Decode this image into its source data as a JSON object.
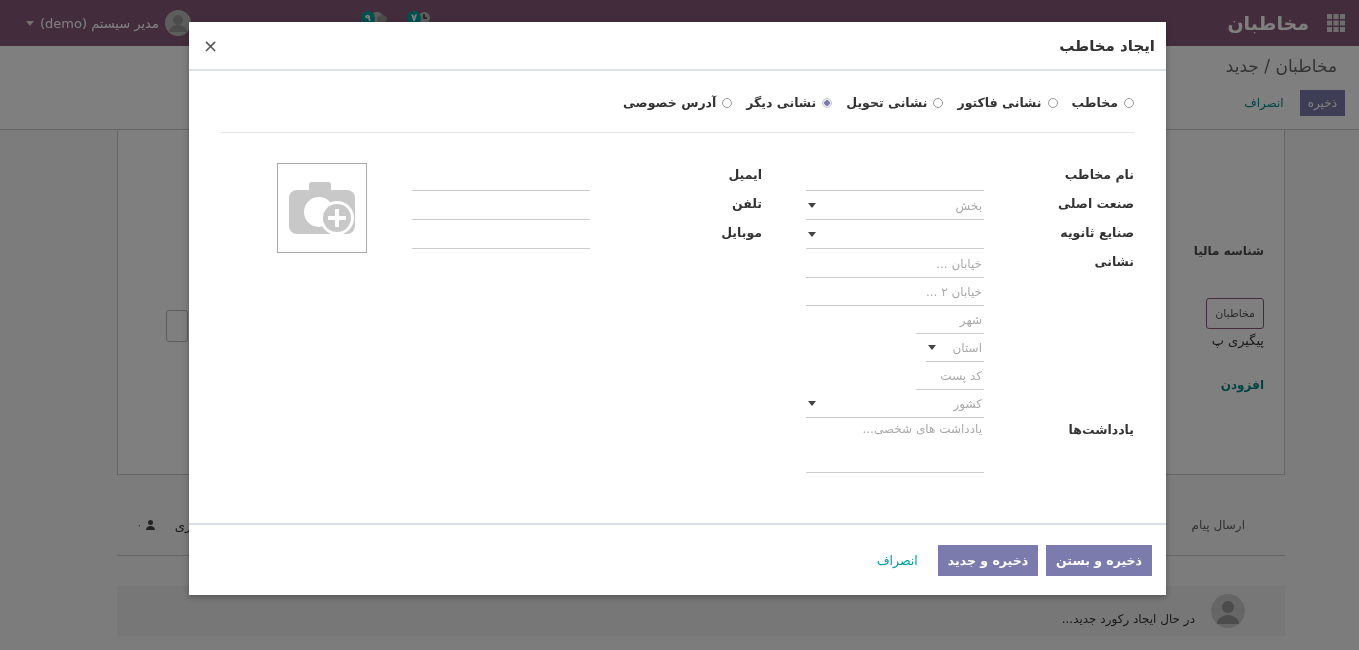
{
  "navbar": {
    "brand": "مخاطبان",
    "activity_count": "۷",
    "message_count": "۹",
    "user": "مدیر سیستم (demo)"
  },
  "control_panel": {
    "breadcrumb": "مخاطبان / جدید",
    "buttons": [
      {
        "label": "ذخیره",
        "kind": "primary"
      },
      {
        "label": "انصراف",
        "kind": "link"
      }
    ]
  },
  "sheet": {
    "tax_label": "شناسه مالیا",
    "contacts_button": "مخاطبان",
    "followup_text": "پیگیری پ",
    "add_link": "افزودن"
  },
  "chatter": {
    "send_message": "ارسال پیام",
    "log_note": "ری",
    "followers_count": "۰",
    "message": "در حال ایجاد رکورد جدید..."
  },
  "dialog": {
    "title": "ایجاد مخاطب",
    "close": "×",
    "radios": [
      {
        "label": "مخاطب",
        "selected": false
      },
      {
        "label": "نشانی فاکتور",
        "selected": false
      },
      {
        "label": "نشانی تحویل",
        "selected": false
      },
      {
        "label": "نشانی دیگر",
        "selected": true
      },
      {
        "label": "آدرس خصوصی",
        "selected": false
      }
    ],
    "right_fields": [
      {
        "label": "نام مخاطب",
        "kind": "text"
      },
      {
        "label": "صنعت اصلی",
        "kind": "select",
        "placeholder": "بخش"
      },
      {
        "label": "صنایع ثانویه",
        "kind": "select"
      },
      {
        "label": "نشانی",
        "kind": "address",
        "parts": [
          {
            "kind": "wide",
            "placeholder": "خیابان ..."
          },
          {
            "kind": "wide",
            "placeholder": "خیابان ۲ ..."
          },
          {
            "kind": "short",
            "placeholder": "شهر"
          },
          {
            "kind": "short-select",
            "placeholder": "استان"
          },
          {
            "kind": "short",
            "placeholder": "کد پست"
          },
          {
            "kind": "select",
            "placeholder": "کشور"
          }
        ]
      },
      {
        "label": "یادداشت‌ها",
        "kind": "textarea",
        "placeholder": "یادداشت های شخصی..."
      }
    ],
    "left_fields": [
      {
        "label": "ایمیل",
        "kind": "text"
      },
      {
        "label": "تلفن",
        "kind": "text"
      },
      {
        "label": "موبایل",
        "kind": "text"
      }
    ],
    "footer_buttons": [
      {
        "label": "ذخیره و بستن",
        "kind": "primary"
      },
      {
        "label": "ذخیره و جدید",
        "kind": "primary"
      },
      {
        "label": "انصراف",
        "kind": "link"
      }
    ]
  }
}
